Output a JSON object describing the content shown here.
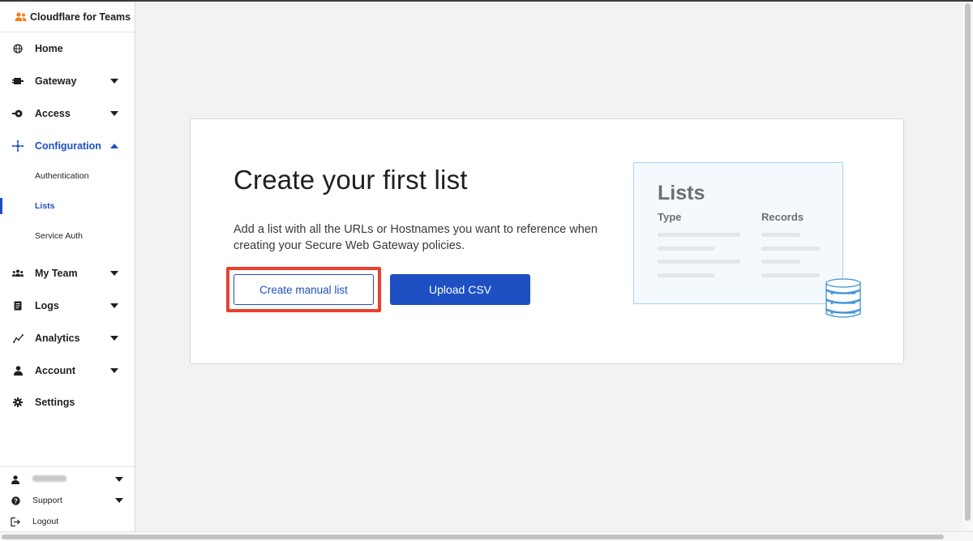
{
  "app": {
    "title": "Cloudflare for Teams"
  },
  "sidebar": {
    "items": [
      {
        "label": "Home",
        "icon": "globe-icon"
      },
      {
        "label": "Gateway",
        "icon": "gateway-icon"
      },
      {
        "label": "Access",
        "icon": "access-icon"
      },
      {
        "label": "Configuration",
        "icon": "configuration-icon",
        "expanded": true
      },
      {
        "label": "My Team",
        "icon": "team-icon"
      },
      {
        "label": "Logs",
        "icon": "logs-icon"
      },
      {
        "label": "Analytics",
        "icon": "analytics-icon"
      },
      {
        "label": "Account",
        "icon": "account-icon"
      },
      {
        "label": "Settings",
        "icon": "gear-icon"
      }
    ],
    "configuration_sub": [
      {
        "label": "Authentication"
      },
      {
        "label": "Lists",
        "selected": true
      },
      {
        "label": "Service Auth"
      }
    ],
    "bottom": {
      "support": "Support",
      "logout": "Logout"
    }
  },
  "main": {
    "title": "Create your first list",
    "description": "Add a list with all the URLs or Hostnames you want to reference when creating your Secure Web Gateway policies.",
    "create_button": "Create manual list",
    "upload_button": "Upload CSV",
    "illustration": {
      "title": "Lists",
      "col_type": "Type",
      "col_records": "Records"
    }
  },
  "colors": {
    "accent": "#1e4fc2",
    "highlight": "#e9412e",
    "brand_orange": "#f38020"
  }
}
